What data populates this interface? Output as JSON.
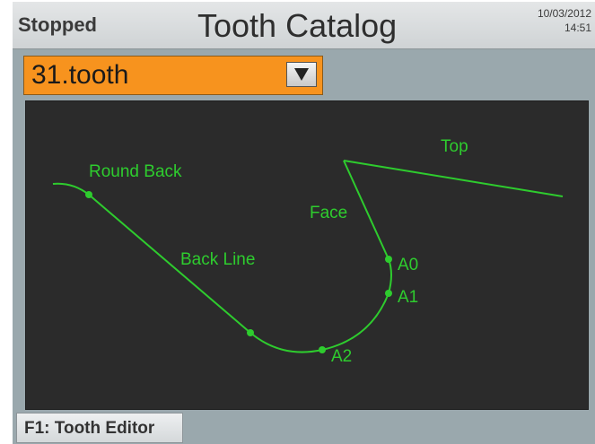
{
  "header": {
    "status": "Stopped",
    "title": "Tooth Catalog",
    "date": "10/03/2012",
    "time": "14:51"
  },
  "selector": {
    "value": "31.tooth",
    "icon": "dropdown-arrow-icon"
  },
  "diagram": {
    "labels": {
      "top": "Top",
      "round_back": "Round Back",
      "face": "Face",
      "back_line": "Back Line",
      "a0": "A0",
      "a1": "A1",
      "a2": "A2"
    },
    "line_color": "#2ecc2e",
    "background": "#2b2b2b"
  },
  "footer": {
    "button_label": "F1: Tooth Editor"
  },
  "colors": {
    "selector_bg": "#f7931e",
    "screen_bg": "#9aa8ad",
    "header_bg": "#d9dcde"
  }
}
